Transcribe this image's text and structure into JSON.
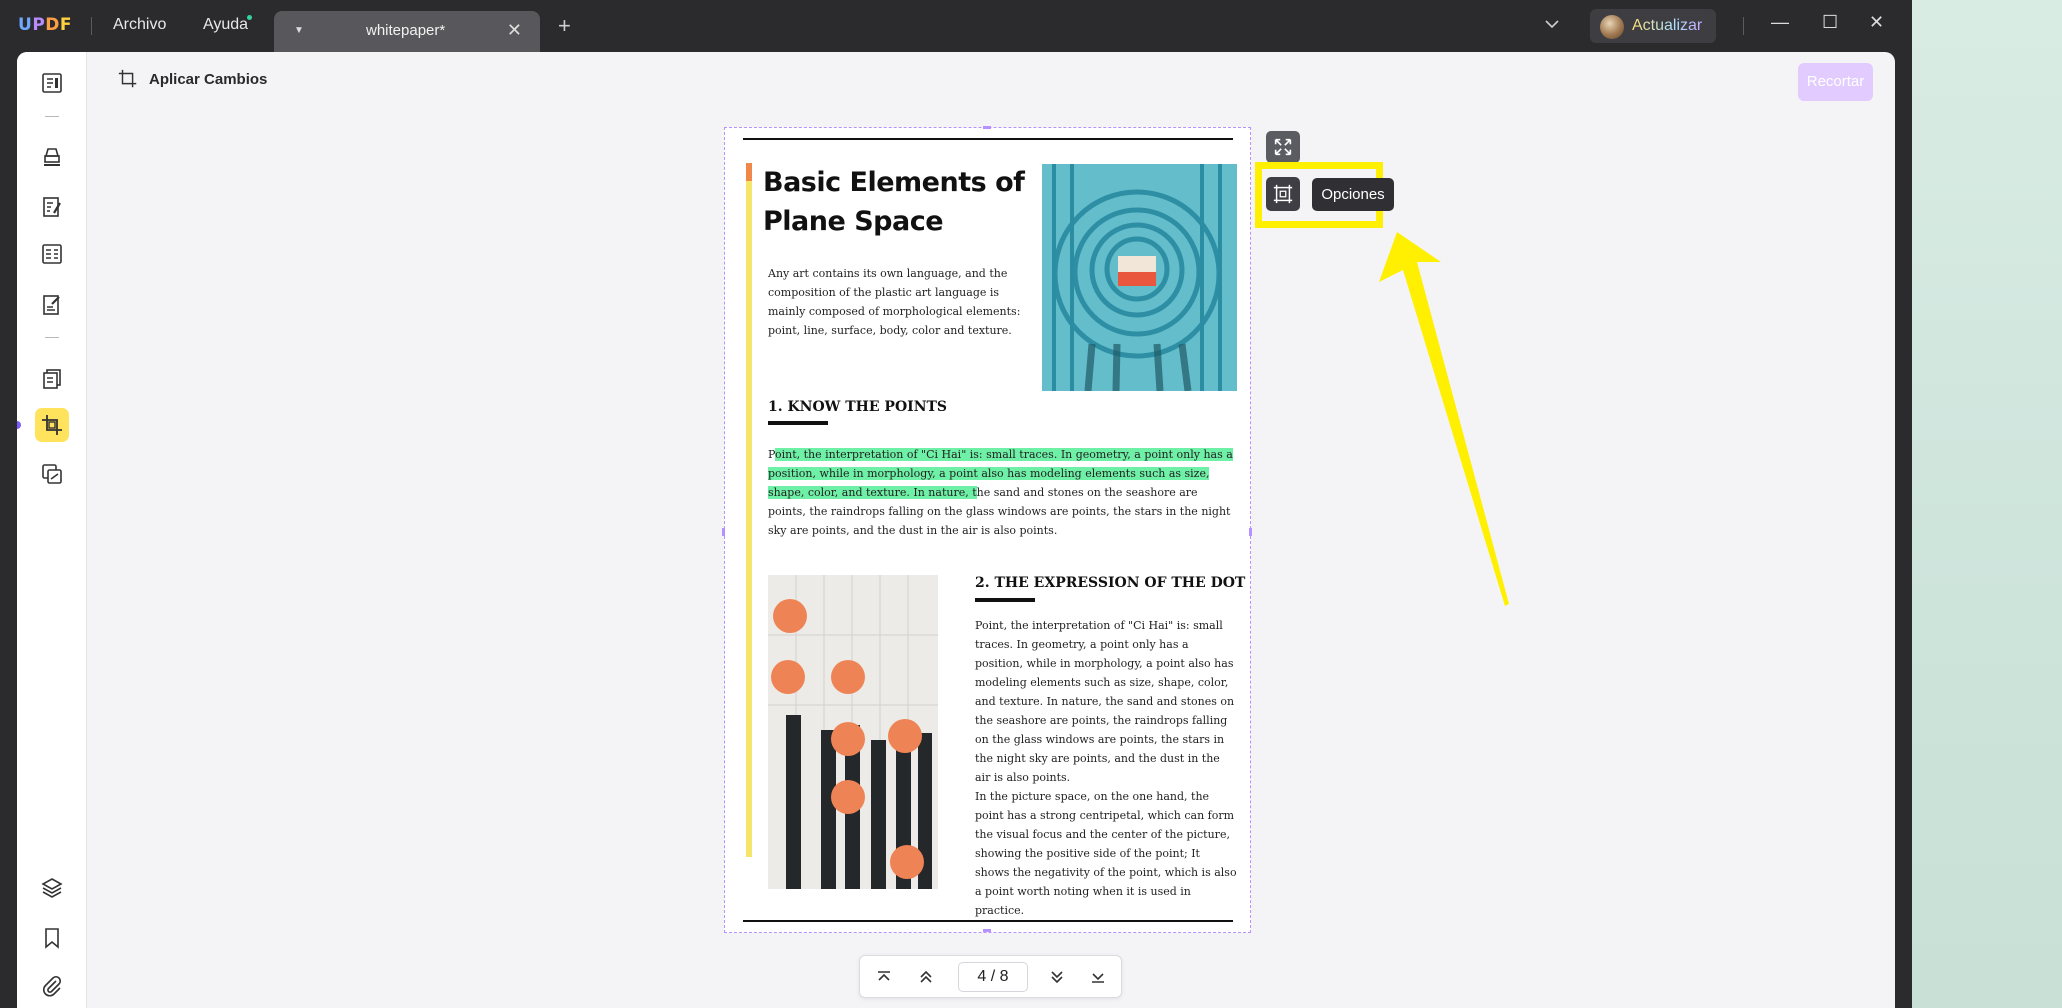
{
  "app": {
    "logo": {
      "u": "U",
      "p": "P",
      "d": "D",
      "f": "F"
    },
    "menu": {
      "file": "Archivo",
      "help": "Ayuda"
    },
    "tab": {
      "title": "whitepaper*",
      "close": "✕",
      "add": "+"
    },
    "upgrade_label": "Actualizar",
    "window_controls": {
      "minimize": "—",
      "maximize": "☐",
      "close": "✕"
    }
  },
  "toolbar": {
    "apply_label": "Aplicar Cambios",
    "crop_label": "Recortar"
  },
  "floating": {
    "options_tooltip": "Opciones",
    "highlight_color": "#ffef00"
  },
  "document": {
    "title": "Basic Elements of Plane Space",
    "intro": "Any art contains its own language, and the composition of the plastic art language is mainly composed of morphological elements: point, line, surface, body, color and texture.",
    "section1_heading": "1. KNOW THE POINTS",
    "section1_p_start": "P",
    "section1_p_highlight": "oint, the interpretation of \"Ci Hai\" is: small traces. In geometry, a point only has a position, while in morphology, a point also has modeling elements such as size, shape, color, and texture. In nature, t",
    "section1_p_rest": "he sand and stones on the seashore are points, the raindrops falling on the glass windows are points, the stars in the night sky are points, and the dust in the air is also points.",
    "section2_heading": "2. THE EXPRESSION OF THE DOT",
    "section2_p1": "Point, the interpretation of \"Ci Hai\" is: small traces. In geometry, a point only has a position, while in morphology, a point also has modeling elements such as size, shape, color, and texture. In nature, the sand and stones on the seashore are points, the raindrops falling on the glass windows are points, the stars in the night sky are points, and the dust in the air is also points.",
    "section2_p2": "In the picture space, on the one hand, the point has a strong centripetal, which can form the visual focus and the center of the picture, showing the positive side of the point; It shows the negativity of the point, which is also a point worth noting when it is used in practice.",
    "highlight_color": "#6ef0a6"
  },
  "pager": {
    "current": "4",
    "separator": "/",
    "total": "8"
  },
  "colors": {
    "accent": "#7c5cff",
    "active_tool": "#ffe35c",
    "crop_button": "#e2cbff"
  }
}
